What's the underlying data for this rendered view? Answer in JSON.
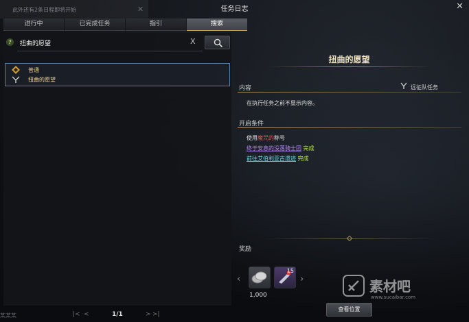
{
  "notice": {
    "text": "此外还有2条日程即将开始",
    "close": "✕"
  },
  "window": {
    "title": "任务日志",
    "close": "✕"
  },
  "tabs": [
    {
      "label": "进行中"
    },
    {
      "label": "已完成任务"
    },
    {
      "label": "指引"
    },
    {
      "label": "搜索"
    }
  ],
  "search": {
    "help": "?",
    "value": "扭曲的愿望",
    "clear": "X"
  },
  "quest_list": [
    {
      "type": "普通",
      "name": "扭曲的愿望"
    }
  ],
  "pager": {
    "first": "|<",
    "prev": "<",
    "page": "1/1",
    "next": ">",
    "last": ">|"
  },
  "detail": {
    "title": "扭曲的愿望",
    "content_label": "内容",
    "expedition_label": "远征队任务",
    "description": "在执行任务之前不显示内容。",
    "conditions_label": "开启条件",
    "cond1_prefix": "使用",
    "cond1_title": "魔咒的",
    "cond1_suffix": "称号",
    "cond2_link": "终于安息的没落骑士团",
    "cond2_status": "完成",
    "cond3_link": "前往艾伯利亚古遗迹",
    "cond3_status": "完成",
    "rewards_label": "奖励",
    "reward1_amount": "1,000",
    "reward2_stack": "15",
    "locate_button": "查看位置",
    "arrow_left": "‹",
    "arrow_right": "›"
  },
  "watermark": {
    "text": "素材吧",
    "url": "www.sucaibar.com"
  },
  "bottom_text": "某某某"
}
